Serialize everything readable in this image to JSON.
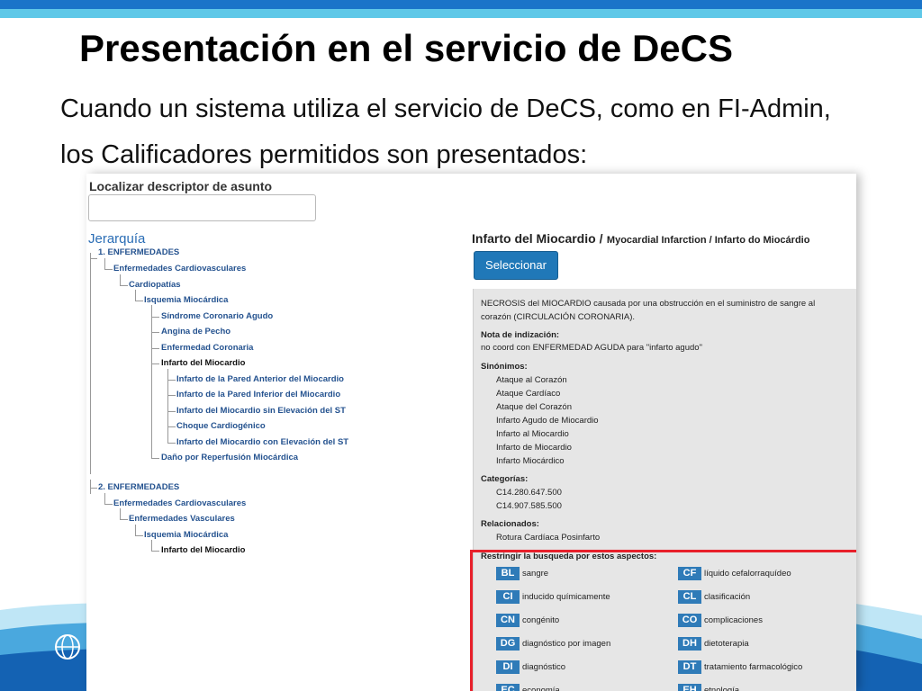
{
  "slide": {
    "title": "Presentación en el servicio de DeCS",
    "intro_line1": "Cuando un sistema utiliza el servicio de DeCS, como en FI-Admin,",
    "intro_line2": "los Calificadores permitidos son presentados:"
  },
  "colors": {
    "accent_blue": "#1a74c9",
    "light_blue": "#5fc8e8",
    "highlight_red": "#e8202b",
    "badge_blue": "#2f7bb8"
  },
  "search": {
    "label": "Localizar descriptor de asunto",
    "value": ""
  },
  "hierarchy": {
    "title": "Jerarquía",
    "tree1": [
      "1. ENFERMEDADES",
      "Enfermedades Cardiovasculares",
      "Cardiopatías",
      "Isquemia Miocárdica",
      "Síndrome Coronario Agudo",
      "Angina de Pecho",
      "Enfermedad Coronaria",
      "Infarto del Miocardio",
      "Infarto de la Pared Anterior del Miocardio",
      "Infarto de la Pared Inferior del Miocardio",
      "Infarto del Miocardio sin Elevación del ST",
      "Choque Cardiogénico",
      "Infarto del Miocardio con Elevación del ST",
      "Daño por Reperfusión Miocárdica"
    ],
    "tree2": [
      "2. ENFERMEDADES",
      "Enfermedades Cardiovasculares",
      "Enfermedades Vasculares",
      "Isquemia Miocárdica",
      "Infarto del Miocardio"
    ]
  },
  "descriptor": {
    "name": "Infarto del Miocardio /",
    "alt_names": "Myocardial Infarction / Infarto do Miocárdio",
    "select_label": "Seleccionar",
    "definition_line1": "NECROSIS del MIOCARDIO causada por una obstrucción en el suministro de sangre al",
    "definition_line2": "corazón (CIRCULACIÓN CORONARIA).",
    "note_title": "Nota de indización:",
    "note_text": "no coord con ENFERMEDAD AGUDA para \"infarto agudo\"",
    "synonyms_title": "Sinónimos:",
    "synonyms": [
      "Ataque al Corazón",
      "Ataque Cardíaco",
      "Ataque del Corazón",
      "Infarto Agudo de Miocardio",
      "Infarto al Miocardio",
      "Infarto de Miocardio",
      "Infarto Miocárdico"
    ],
    "categories_title": "Categorías:",
    "categories": [
      "C14.280.647.500",
      "C14.907.585.500"
    ],
    "related_title": "Relacionados:",
    "related": [
      "Rotura Cardíaca Posinfarto"
    ],
    "restrict_title": "Restringir la busqueda por estos aspectos:",
    "qualifiers": [
      {
        "code": "BL",
        "label": "sangre"
      },
      {
        "code": "CF",
        "label": "líquido cefalorraquídeo"
      },
      {
        "code": "CI",
        "label": "inducido químicamente"
      },
      {
        "code": "CL",
        "label": "clasificación"
      },
      {
        "code": "CN",
        "label": "congénito"
      },
      {
        "code": "CO",
        "label": "complicaciones"
      },
      {
        "code": "DG",
        "label": "diagnóstico por imagen"
      },
      {
        "code": "DH",
        "label": "dietoterapia"
      },
      {
        "code": "DI",
        "label": "diagnóstico"
      },
      {
        "code": "DT",
        "label": "tratamiento farmacológico"
      },
      {
        "code": "EC",
        "label": "economía"
      },
      {
        "code": "EH",
        "label": "etnología"
      }
    ]
  }
}
